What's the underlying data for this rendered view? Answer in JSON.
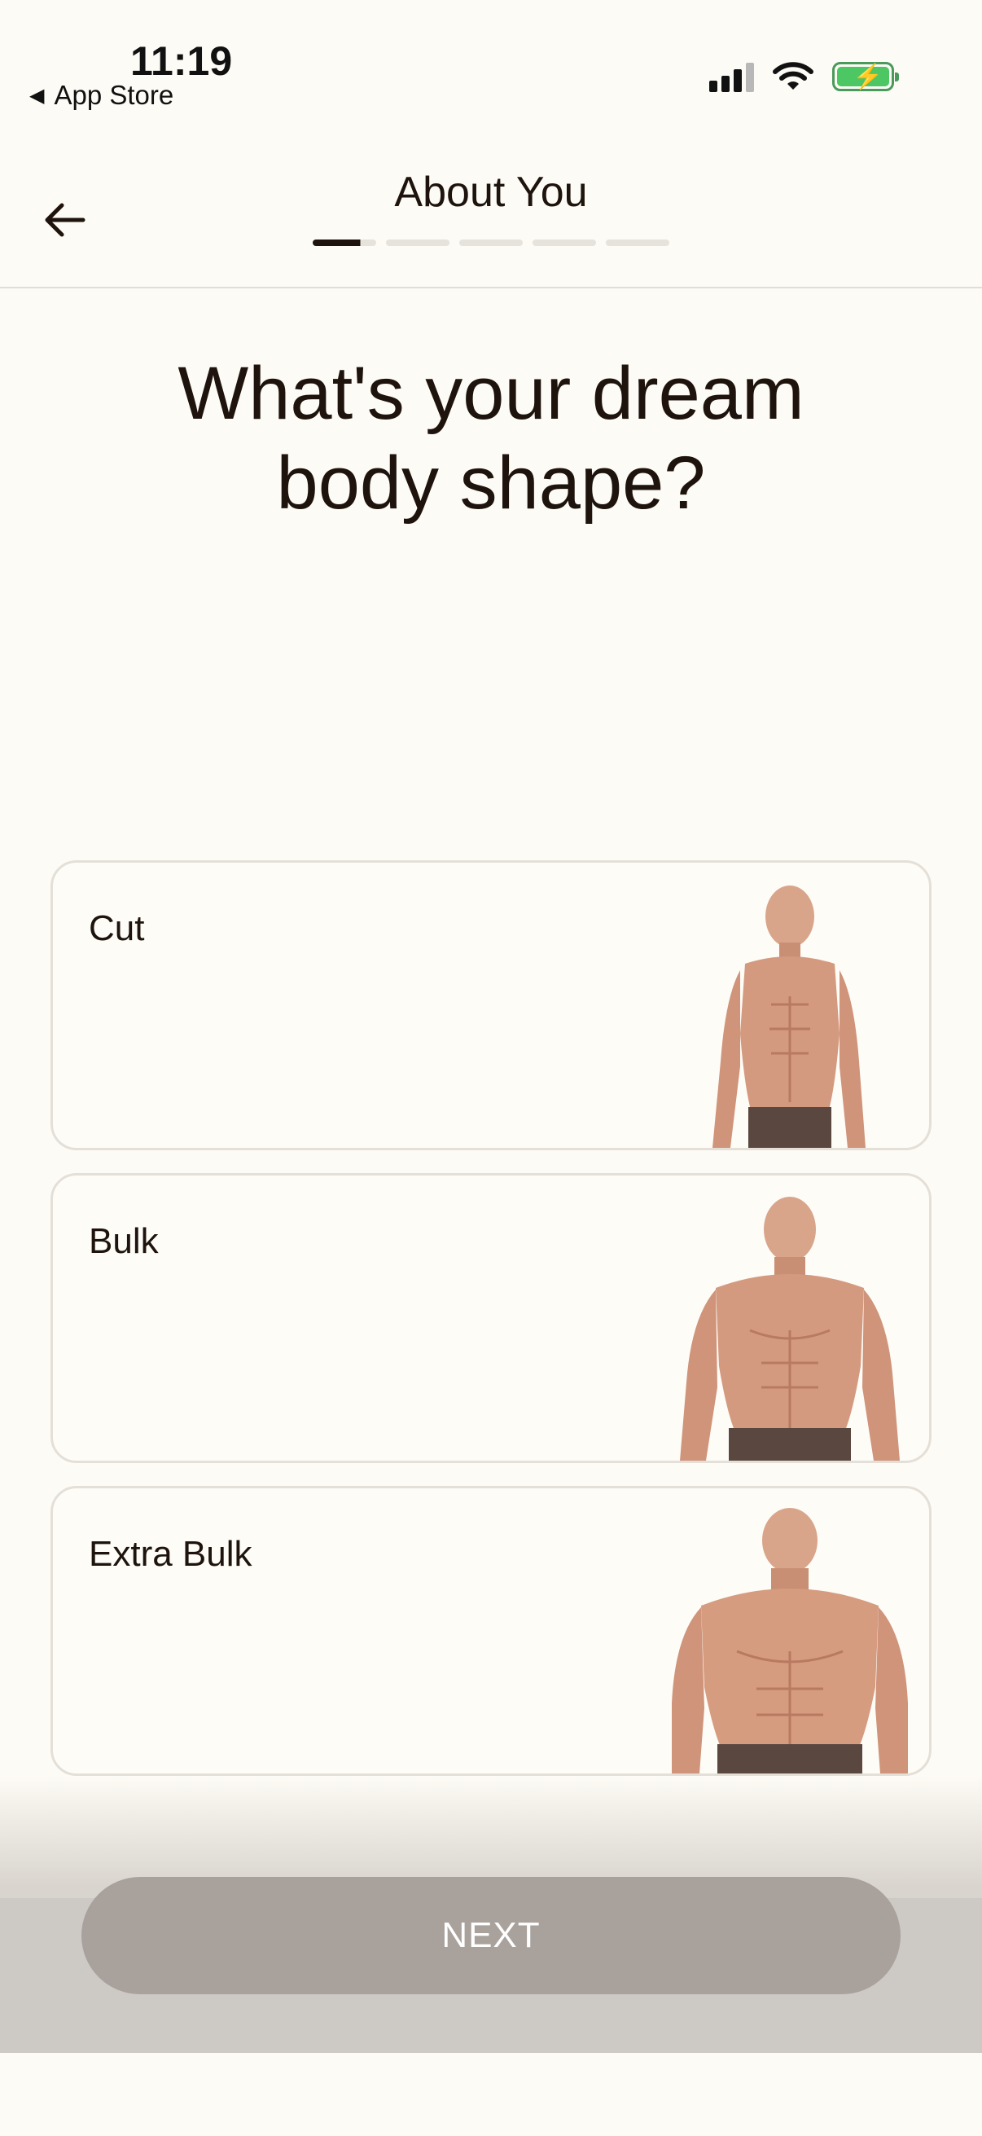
{
  "status_bar": {
    "time": "11:19",
    "back_app": "App Store"
  },
  "header": {
    "title": "About You",
    "progress": {
      "steps": 5,
      "current": 1
    }
  },
  "question": {
    "line1": "What's your dream",
    "line2": "body shape?"
  },
  "options": [
    {
      "label": "Cut",
      "image": "lean-physique"
    },
    {
      "label": "Bulk",
      "image": "muscular-physique"
    },
    {
      "label": "Extra Bulk",
      "image": "heavy-muscular-physique"
    }
  ],
  "next_button": {
    "label": "NEXT",
    "enabled": false
  },
  "colors": {
    "background": "#fdfbf5",
    "text": "#1e140d",
    "button_disabled": "#a9a19b",
    "battery_green": "#4cc764"
  }
}
